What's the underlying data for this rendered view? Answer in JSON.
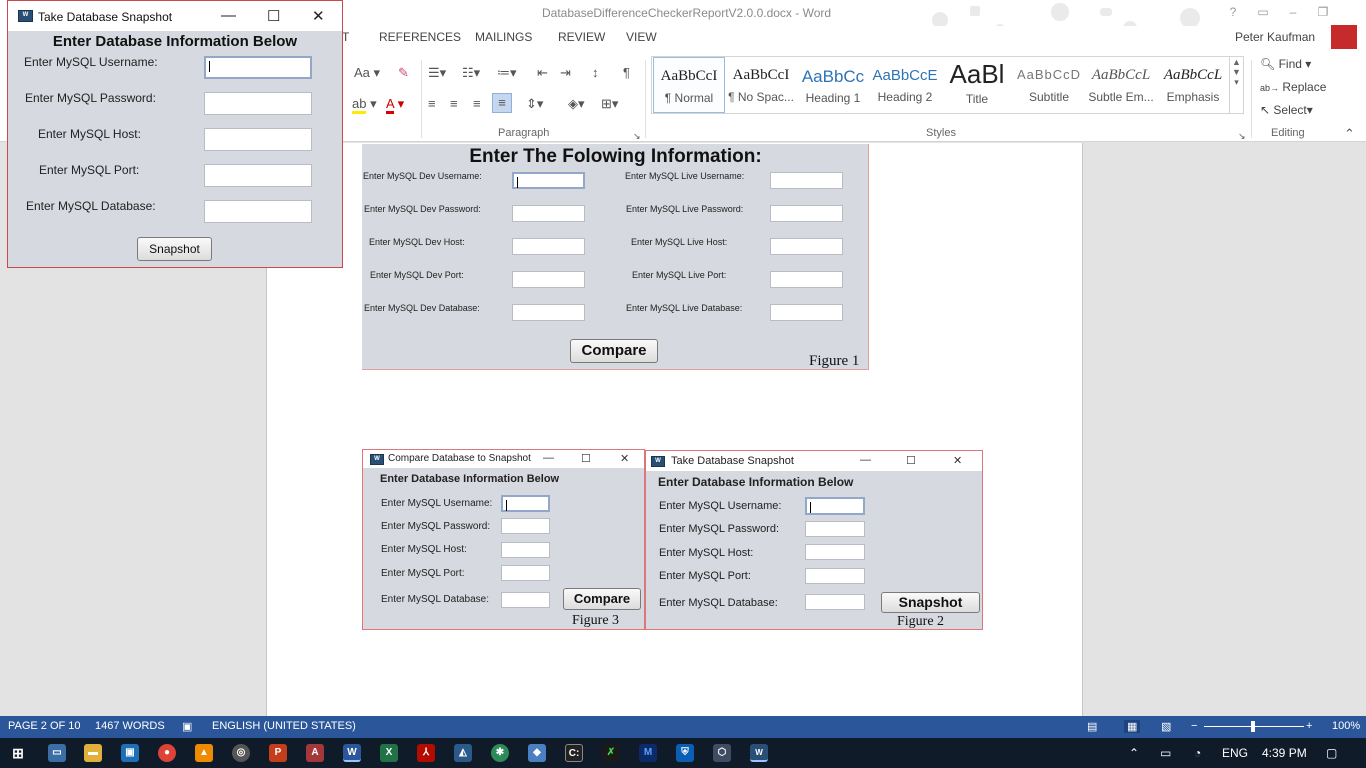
{
  "word": {
    "title": "DatabaseDifferenceCheckerReportV2.0.0.docx - Word",
    "user": "Peter Kaufman",
    "tabs": [
      "REFERENCES",
      "MAILINGS",
      "REVIEW",
      "VIEW"
    ],
    "partial_tab": "T",
    "groups": {
      "paragraph": "Paragraph",
      "styles": "Styles",
      "editing": "Editing"
    },
    "styles": [
      {
        "sample": "AaBbCcI",
        "name": "¶ Normal"
      },
      {
        "sample": "AaBbCcI",
        "name": "¶ No Spac..."
      },
      {
        "sample": "AaBbCc",
        "name": "Heading 1"
      },
      {
        "sample": "AaBbCcE",
        "name": "Heading 2"
      },
      {
        "sample": "AaBl",
        "name": "Title"
      },
      {
        "sample": "AaBbCcD",
        "name": "Subtitle"
      },
      {
        "sample": "AaBbCcL",
        "name": "Subtle Em..."
      },
      {
        "sample": "AaBbCcL",
        "name": "Emphasis"
      }
    ],
    "editing": {
      "find": "Find",
      "replace": "Replace",
      "select": "Select"
    },
    "font_case_label": "Aa"
  },
  "figure1": {
    "title": "Enter The Folowing Information:",
    "left_labels": [
      "Enter MySQL Dev Username:",
      "Enter MySQL Dev Password:",
      "Enter MySQL Dev Host:",
      "Enter MySQL Dev Port:",
      "Enter MySQL Dev Database:"
    ],
    "right_labels": [
      "Enter MySQL Live Username:",
      "Enter MySQL Live Password:",
      "Enter MySQL Live Host:",
      "Enter MySQL Live Port:",
      "Enter MySQL Live Database:"
    ],
    "button": "Compare",
    "caption": "Figure 1"
  },
  "figure3": {
    "window_title": "Compare Database to Snapshot",
    "heading": "Enter Database Information Below",
    "labels": [
      "Enter MySQL Username:",
      "Enter MySQL Password:",
      "Enter MySQL Host:",
      "Enter MySQL Port:",
      "Enter MySQL Database:"
    ],
    "button": "Compare",
    "caption": "Figure 3"
  },
  "figure2": {
    "window_title": "Take Database Snapshot",
    "heading": "Enter Database Information Below",
    "labels": [
      "Enter MySQL Username:",
      "Enter MySQL Password:",
      "Enter MySQL Host:",
      "Enter MySQL Port:",
      "Enter MySQL Database:"
    ],
    "button": "Snapshot",
    "caption": "Figure 2"
  },
  "snapshot_window": {
    "title": "Take Database Snapshot",
    "heading": "Enter Database Information Below",
    "labels": [
      "Enter MySQL Username:",
      "Enter MySQL Password:",
      "Enter MySQL Host:",
      "Enter MySQL Port:",
      "Enter MySQL Database:"
    ],
    "button": "Snapshot",
    "app_icon": "java-app-icon"
  },
  "statusbar": {
    "page": "PAGE 2 OF 10",
    "words": "1467 WORDS",
    "language": "ENGLISH (UNITED STATES)",
    "zoom": "100%",
    "zoom_level": 1.0
  },
  "taskbar": {
    "language": "ENG",
    "time": "4:39 PM",
    "apps": [
      "file-explorer-icon",
      "folder-icon",
      "word-icon",
      "excel-icon",
      "acrobat-icon",
      "vlc-icon",
      "chrome-icon",
      "powerpoint-icon",
      "access-icon"
    ]
  },
  "colors": {
    "word_blue": "#2b579a",
    "taskbar": "#101b2a",
    "swing_bg": "#d6d9df",
    "window_border": "#c94a4a"
  }
}
